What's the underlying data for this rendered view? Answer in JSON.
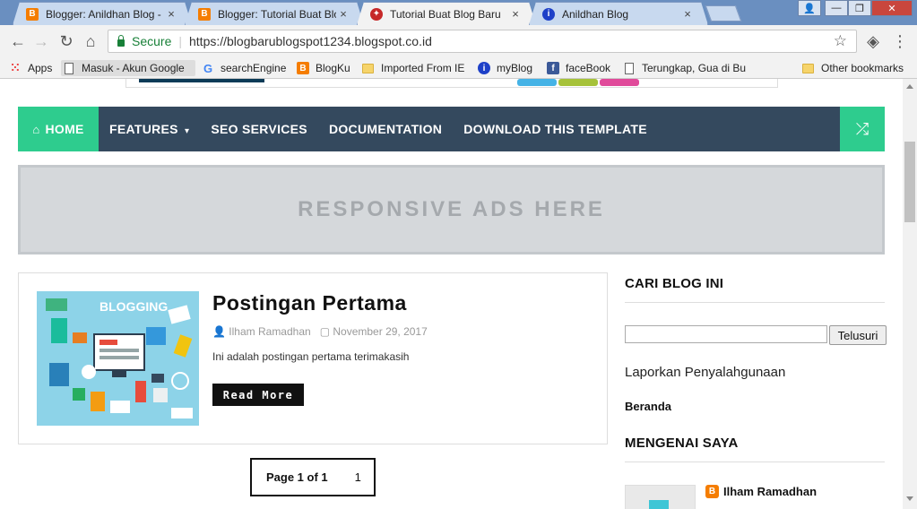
{
  "browser": {
    "tabs": [
      {
        "title": "Blogger: Anildhan Blog -",
        "favicon": "blogger-icon",
        "close": "×"
      },
      {
        "title": "Blogger: Tutorial Buat Blo",
        "favicon": "blogger-icon",
        "close": "×"
      },
      {
        "title": "Tutorial Buat Blog Baru",
        "favicon": "garuda-icon",
        "close": "×",
        "active": true
      },
      {
        "title": "Anildhan Blog",
        "favicon": "anildhan-icon",
        "close": "×"
      }
    ],
    "address": {
      "secure_label": "Secure",
      "url": "https://blogbarublogspot1234.blogspot.co.id"
    },
    "bookmarks": [
      {
        "label": "Apps",
        "icon": "apps-grid-icon"
      },
      {
        "label": "Masuk - Akun Google",
        "icon": "page-icon"
      },
      {
        "label": "searchEngine",
        "icon": "google-icon"
      },
      {
        "label": "BlogKu",
        "icon": "blogger-icon"
      },
      {
        "label": "Imported From IE",
        "icon": "folder-icon"
      },
      {
        "label": "myBlog",
        "icon": "anildhan-icon"
      },
      {
        "label": "faceBook",
        "icon": "facebook-icon"
      },
      {
        "label": "Terungkap, Gua di Bu",
        "icon": "page-icon"
      },
      {
        "label": "Other bookmarks",
        "icon": "folder-icon"
      }
    ]
  },
  "site": {
    "nav": {
      "home": "HOME",
      "features": "FEATURES",
      "seo": "SEO SERVICES",
      "documentation": "DOCUMENTATION",
      "download": "DOWNLOAD THIS TEMPLATE"
    },
    "ads_text": "RESPONSIVE ADS HERE",
    "post": {
      "title": "Postingan Pertama",
      "author": "Ilham Ramadhan",
      "date": "November 29, 2017",
      "excerpt": "Ini adalah postingan pertama terimakasih",
      "read_more": "Read More",
      "image_label": "BLOGGING"
    },
    "pager": {
      "label": "Page 1 of 1",
      "current": "1"
    },
    "sidebar": {
      "search_heading": "CARI BLOG INI",
      "search_button": "Telusuri",
      "report_link": "Laporkan Penyalahgunaan",
      "home_link": "Beranda",
      "about_heading": "MENGENAI SAYA",
      "profile_name": "Ilham Ramadhan"
    },
    "colors": {
      "nav_bg": "#34495e",
      "accent": "#2ecc8e"
    }
  }
}
